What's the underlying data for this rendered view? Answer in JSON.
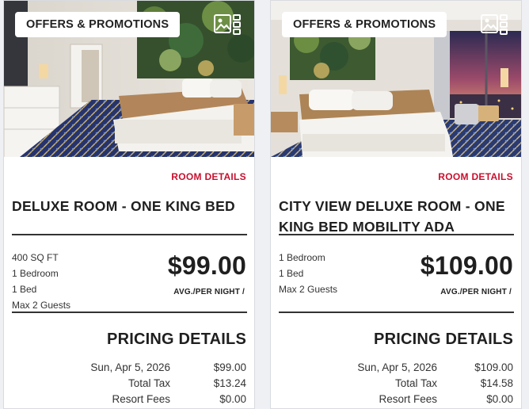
{
  "cards": [
    {
      "badge": "OFFERS & PROMOTIONS",
      "room_details_link": "ROOM DETAILS",
      "title": "DELUXE ROOM - ONE KING BED",
      "features": [
        "400 SQ FT",
        "1 Bedroom",
        "1 Bed",
        "Max 2 Guests"
      ],
      "price": "$99.00",
      "price_note": "AVG./PER NIGHT /",
      "pricing_title": "PRICING DETAILS",
      "pricing_rows": [
        {
          "label": "Sun, Apr 5, 2026",
          "value": "$99.00"
        },
        {
          "label": "Total Tax",
          "value": "$13.24"
        },
        {
          "label": "Resort Fees",
          "value": "$0.00"
        }
      ]
    },
    {
      "badge": "OFFERS & PROMOTIONS",
      "room_details_link": "ROOM DETAILS",
      "title": "CITY VIEW DELUXE ROOM - ONE KING BED MOBILITY ADA",
      "features": [
        "1 Bedroom",
        "1 Bed",
        "Max 2 Guests"
      ],
      "price": "$109.00",
      "price_note": "AVG./PER NIGHT /",
      "pricing_title": "PRICING DETAILS",
      "pricing_rows": [
        {
          "label": "Sun, Apr 5, 2026",
          "value": "$109.00"
        },
        {
          "label": "Total Tax",
          "value": "$14.58"
        },
        {
          "label": "Resort Fees",
          "value": "$0.00"
        }
      ]
    }
  ],
  "icons": {
    "gallery": "gallery-icon"
  },
  "colors": {
    "accent_red": "#c8102e",
    "text_dark": "#1f1f1f"
  }
}
